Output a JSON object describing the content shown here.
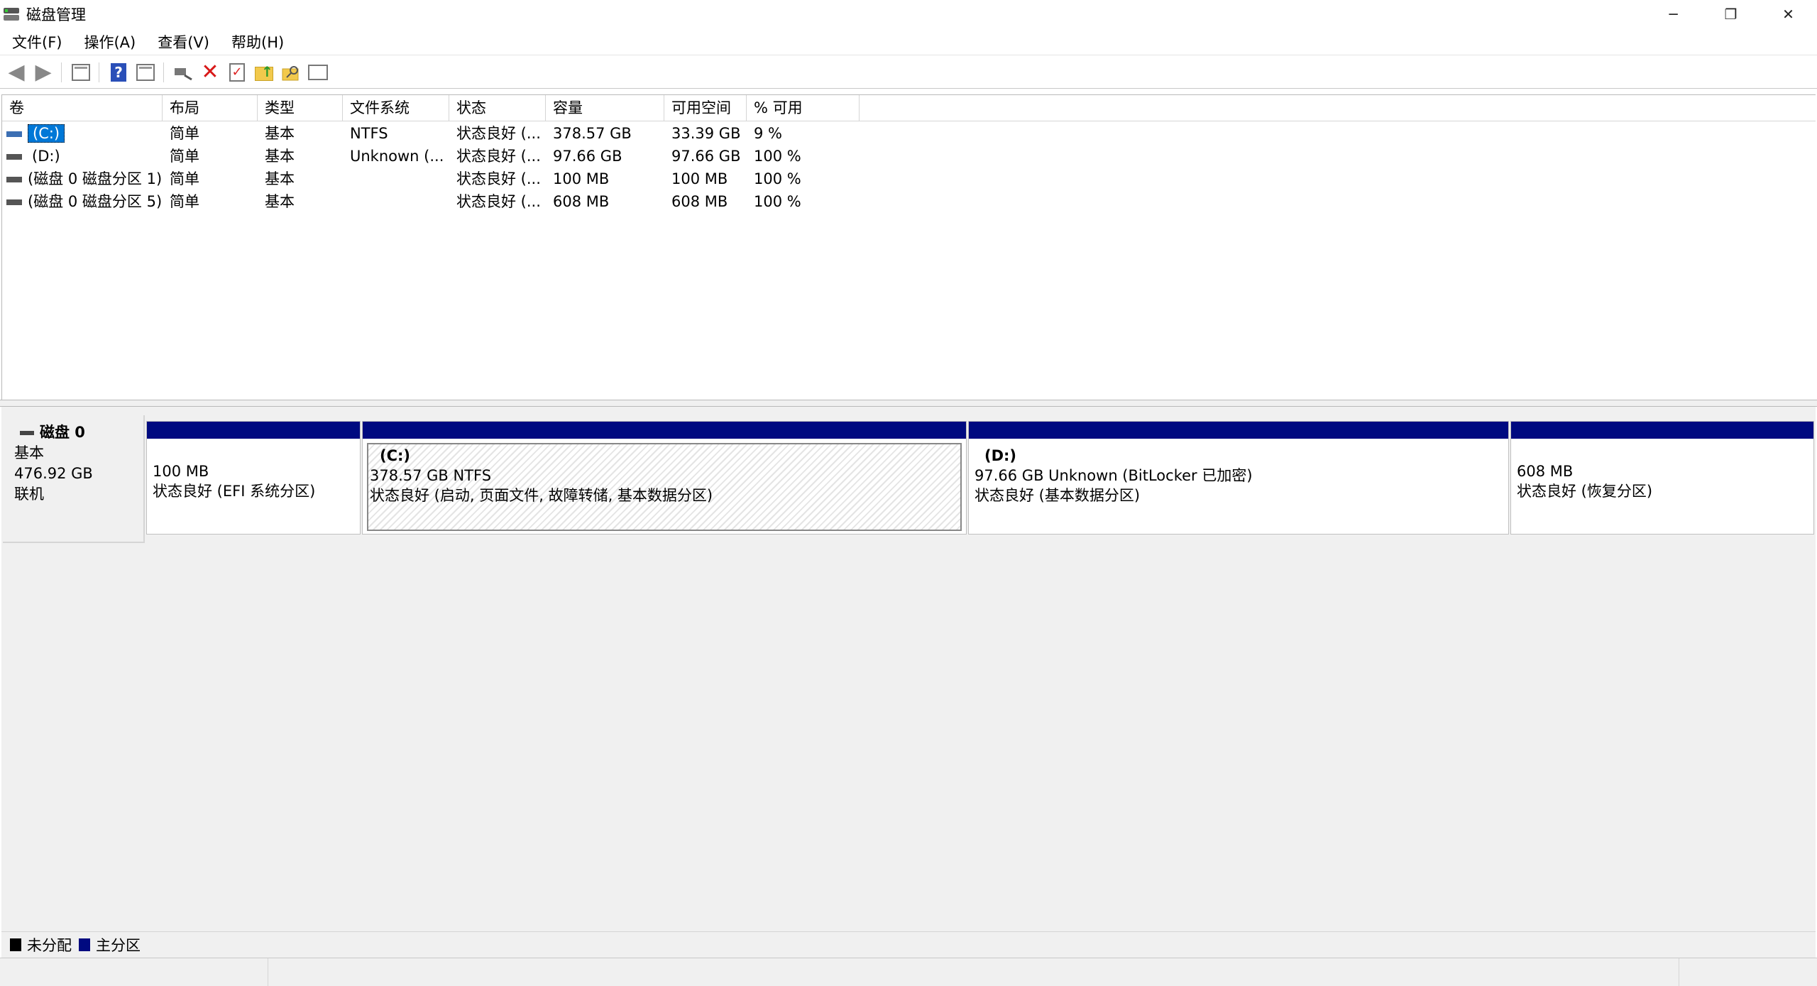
{
  "window": {
    "title": "磁盘管理",
    "controls": {
      "minimize": "─",
      "restore": "❐",
      "close": "✕"
    }
  },
  "menu": [
    {
      "label": "文件(F)"
    },
    {
      "label": "操作(A)"
    },
    {
      "label": "查看(V)"
    },
    {
      "label": "帮助(H)"
    }
  ],
  "toolbar": {
    "icons": [
      "back-arrow-icon",
      "forward-arrow-icon",
      "console-tree-icon",
      "help-icon",
      "view-icon",
      "connect-disk-icon",
      "delete-icon",
      "properties-check-icon",
      "folder-up-icon",
      "search-folder-icon",
      "settings-panel-icon"
    ]
  },
  "volumes": {
    "columns": [
      "卷",
      "布局",
      "类型",
      "文件系统",
      "状态",
      "容量",
      "可用空间",
      "% 可用"
    ],
    "rows": [
      {
        "name": "(C:)",
        "layout": "简单",
        "type": "基本",
        "fs": "NTFS",
        "status": "状态良好 (...",
        "capacity": "378.57 GB",
        "free": "33.39 GB",
        "pct": "9 %",
        "selected": true
      },
      {
        "name": "(D:)",
        "layout": "简单",
        "type": "基本",
        "fs": "Unknown (...",
        "status": "状态良好 (...",
        "capacity": "97.66 GB",
        "free": "97.66 GB",
        "pct": "100 %"
      },
      {
        "name": "(磁盘 0 磁盘分区 1)",
        "layout": "简单",
        "type": "基本",
        "fs": "",
        "status": "状态良好 (...",
        "capacity": "100 MB",
        "free": "100 MB",
        "pct": "100 %"
      },
      {
        "name": "(磁盘 0 磁盘分区 5)",
        "layout": "简单",
        "type": "基本",
        "fs": "",
        "status": "状态良好 (...",
        "capacity": "608 MB",
        "free": "608 MB",
        "pct": "100 %"
      }
    ]
  },
  "disk": {
    "name": "磁盘 0",
    "kind": "基本",
    "size": "476.92 GB",
    "state": "联机",
    "partitions": [
      {
        "name": "",
        "line1": "100 MB",
        "line2": "状态良好 (EFI 系统分区)"
      },
      {
        "name": "(C:)",
        "line1": "378.57 GB NTFS",
        "line2": "状态良好 (启动, 页面文件, 故障转储, 基本数据分区)"
      },
      {
        "name": "(D:)",
        "line1": "97.66 GB Unknown (BitLocker 已加密)",
        "line2": "状态良好 (基本数据分区)"
      },
      {
        "name": "",
        "line1": "608 MB",
        "line2": "状态良好 (恢复分区)"
      }
    ]
  },
  "legend": [
    {
      "label": "未分配",
      "color": "#000000"
    },
    {
      "label": "主分区",
      "color": "#000a80"
    }
  ],
  "colors": {
    "primary_partition": "#000a80",
    "selection": "#0078d7"
  }
}
